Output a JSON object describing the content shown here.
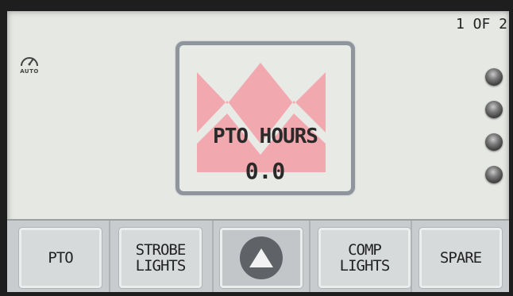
{
  "page_indicator": "1 OF 2",
  "auto_mode": {
    "label": "AUTO",
    "icon": "gauge-icon"
  },
  "hour_meter": {
    "title": "PTO HOURS",
    "value": "0.0",
    "watermark_icon": "crown-logo-icon"
  },
  "indicators": [
    {
      "name": "indicator-light-1",
      "state": "off"
    },
    {
      "name": "indicator-light-2",
      "state": "off"
    },
    {
      "name": "indicator-light-3",
      "state": "off"
    },
    {
      "name": "indicator-light-4",
      "state": "off"
    }
  ],
  "buttons": {
    "pto": "PTO",
    "strobe_line1": "STROBE",
    "strobe_line2": "LIGHTS",
    "up_icon": "up-arrow-icon",
    "comp_line1": "COMP",
    "comp_line2": "LIGHTS",
    "spare": "SPARE"
  },
  "colors": {
    "crown_watermark": "#f0a8ae",
    "card_border": "#8f959c",
    "up_button_circle": "#5f6267"
  }
}
